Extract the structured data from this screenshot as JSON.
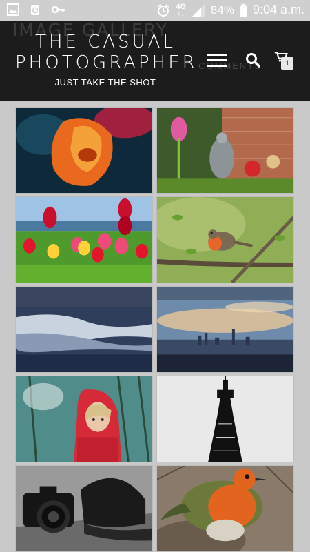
{
  "status_bar": {
    "network": "4G",
    "battery": "84%",
    "time": "9:04 a.m.",
    "left_icons": [
      "gallery-icon",
      "recycle-icon",
      "key-icon"
    ],
    "right_icons": [
      "alarm-icon",
      "signal-icon",
      "battery-icon"
    ]
  },
  "header": {
    "ghost_title": "IMAGE GALLERY",
    "ghost_comments": "COMMENTS",
    "brand_line1": "THE CASUAL",
    "brand_line2": "PHOTOGRAPHER",
    "tagline": "JUST TAKE THE SHOT",
    "cart_count": "1",
    "icons": [
      "hamburger-menu-icon",
      "search-icon",
      "cart-icon"
    ]
  },
  "colors": {
    "header_bg": "#1c1c1c",
    "page_bg": "#c9c9c9"
  },
  "gallery": {
    "photos": [
      {
        "subject": "orange-tulip"
      },
      {
        "subject": "garden-statue-pink-flower"
      },
      {
        "subject": "tulip-field"
      },
      {
        "subject": "robin-on-branch"
      },
      {
        "subject": "cloudy-sky"
      },
      {
        "subject": "city-skyline"
      },
      {
        "subject": "girl-red-hood"
      },
      {
        "subject": "blackpool-tower"
      },
      {
        "subject": "camera-and-cap"
      },
      {
        "subject": "robin-close-up"
      }
    ]
  }
}
